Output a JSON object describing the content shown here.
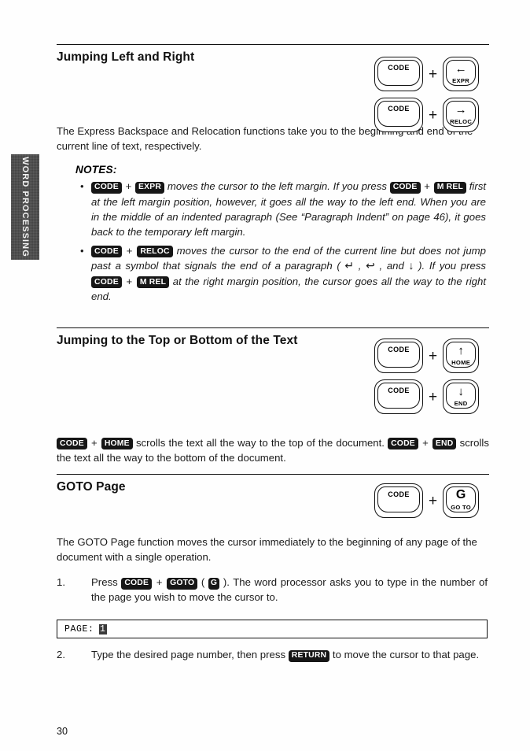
{
  "page": {
    "folio": "30",
    "side_tab": "WORD PROCESSING"
  },
  "sections": [
    {
      "heading": "Jumping Left and Right",
      "intro": "The Express Backspace and Relocation functions take you to the beginning and end of the current line of text, respectively.",
      "notes_title": "NOTES:",
      "keycaps": [
        {
          "left": {
            "main": "CODE"
          },
          "op": "+",
          "right": {
            "arrow": "←",
            "sub": "EXPR"
          }
        },
        {
          "left": {
            "main": "CODE"
          },
          "op": "+",
          "right": {
            "arrow": "→",
            "sub": "RELOC"
          }
        }
      ],
      "notes": [
        {
          "parts": [
            {
              "type": "kbd",
              "text": "CODE"
            },
            {
              "type": "plus",
              "text": "+"
            },
            {
              "type": "kbd",
              "text": "EXPR"
            },
            {
              "type": "text",
              "text": " moves the cursor to the left margin. If you press "
            },
            {
              "type": "kbd",
              "text": "CODE"
            },
            {
              "type": "plus",
              "text": "+"
            },
            {
              "type": "kbd",
              "text": "M REL"
            },
            {
              "type": "text",
              "text": " first at the left margin position, however, it goes all the way to the left end. When you are in the middle of an indented paragraph (See “Paragraph Indent” on page 46), it goes back to the temporary left margin."
            }
          ]
        },
        {
          "parts": [
            {
              "type": "kbd",
              "text": "CODE"
            },
            {
              "type": "plus",
              "text": "+"
            },
            {
              "type": "kbd",
              "text": "RELOC"
            },
            {
              "type": "text",
              "text": " moves the cursor to the end of the current line but does not jump past a symbol that signals the end of a paragraph ( "
            },
            {
              "type": "sym",
              "text": "↵"
            },
            {
              "type": "text",
              "text": " , "
            },
            {
              "type": "sym",
              "text": "↩"
            },
            {
              "type": "text",
              "text": " , and "
            },
            {
              "type": "sym",
              "text": "↓"
            },
            {
              "type": "text",
              "text": " ). If you press "
            },
            {
              "type": "kbd",
              "text": "CODE"
            },
            {
              "type": "plus",
              "text": "+"
            },
            {
              "type": "kbd",
              "text": "M REL"
            },
            {
              "type": "text",
              "text": " at the right margin position, the cursor goes all the way to the right end."
            }
          ]
        }
      ]
    },
    {
      "heading": "Jumping to the Top or Bottom of the Text",
      "keycaps": [
        {
          "left": {
            "main": "CODE"
          },
          "op": "+",
          "right": {
            "arrow": "↑",
            "sub": "HOME"
          }
        },
        {
          "left": {
            "main": "CODE"
          },
          "op": "+",
          "right": {
            "arrow": "↓",
            "sub": "END"
          }
        }
      ],
      "body_parts": [
        {
          "type": "kbd",
          "text": "CODE"
        },
        {
          "type": "plus",
          "text": "+"
        },
        {
          "type": "kbd",
          "text": "HOME"
        },
        {
          "type": "text",
          "text": " scrolls the text all the way to the top of the document. "
        },
        {
          "type": "kbd",
          "text": "CODE"
        },
        {
          "type": "plus",
          "text": "+"
        },
        {
          "type": "kbd",
          "text": "END"
        },
        {
          "type": "text",
          "text": " scrolls the text all the way to the bottom of the document."
        }
      ]
    },
    {
      "heading": "GOTO Page",
      "keycaps": [
        {
          "left": {
            "main": "CODE"
          },
          "op": "+",
          "right": {
            "glyph": "G",
            "sub": "GO TO"
          }
        }
      ],
      "intro": "The GOTO Page function moves the cursor immediately to the beginning of any page of the document with a single operation.",
      "steps": [
        {
          "num": "1.",
          "parts": [
            {
              "type": "text",
              "text": "Press "
            },
            {
              "type": "kbd",
              "text": "CODE"
            },
            {
              "type": "plus",
              "text": "+"
            },
            {
              "type": "kbd",
              "text": "GOTO"
            },
            {
              "type": "text",
              "text": " ("
            },
            {
              "type": "kbd",
              "text": "G"
            },
            {
              "type": "text",
              "text": "). The word processor asks you to type in the number of the page you wish to move the cursor to."
            }
          ]
        },
        {
          "num": "2.",
          "parts": [
            {
              "type": "text",
              "text": "Type the desired page number, then press "
            },
            {
              "type": "kbd",
              "text": "RETURN"
            },
            {
              "type": "text",
              "text": " to move the cursor to that page."
            }
          ]
        }
      ],
      "prompt": {
        "label": "PAGE:",
        "value": "1"
      }
    }
  ]
}
